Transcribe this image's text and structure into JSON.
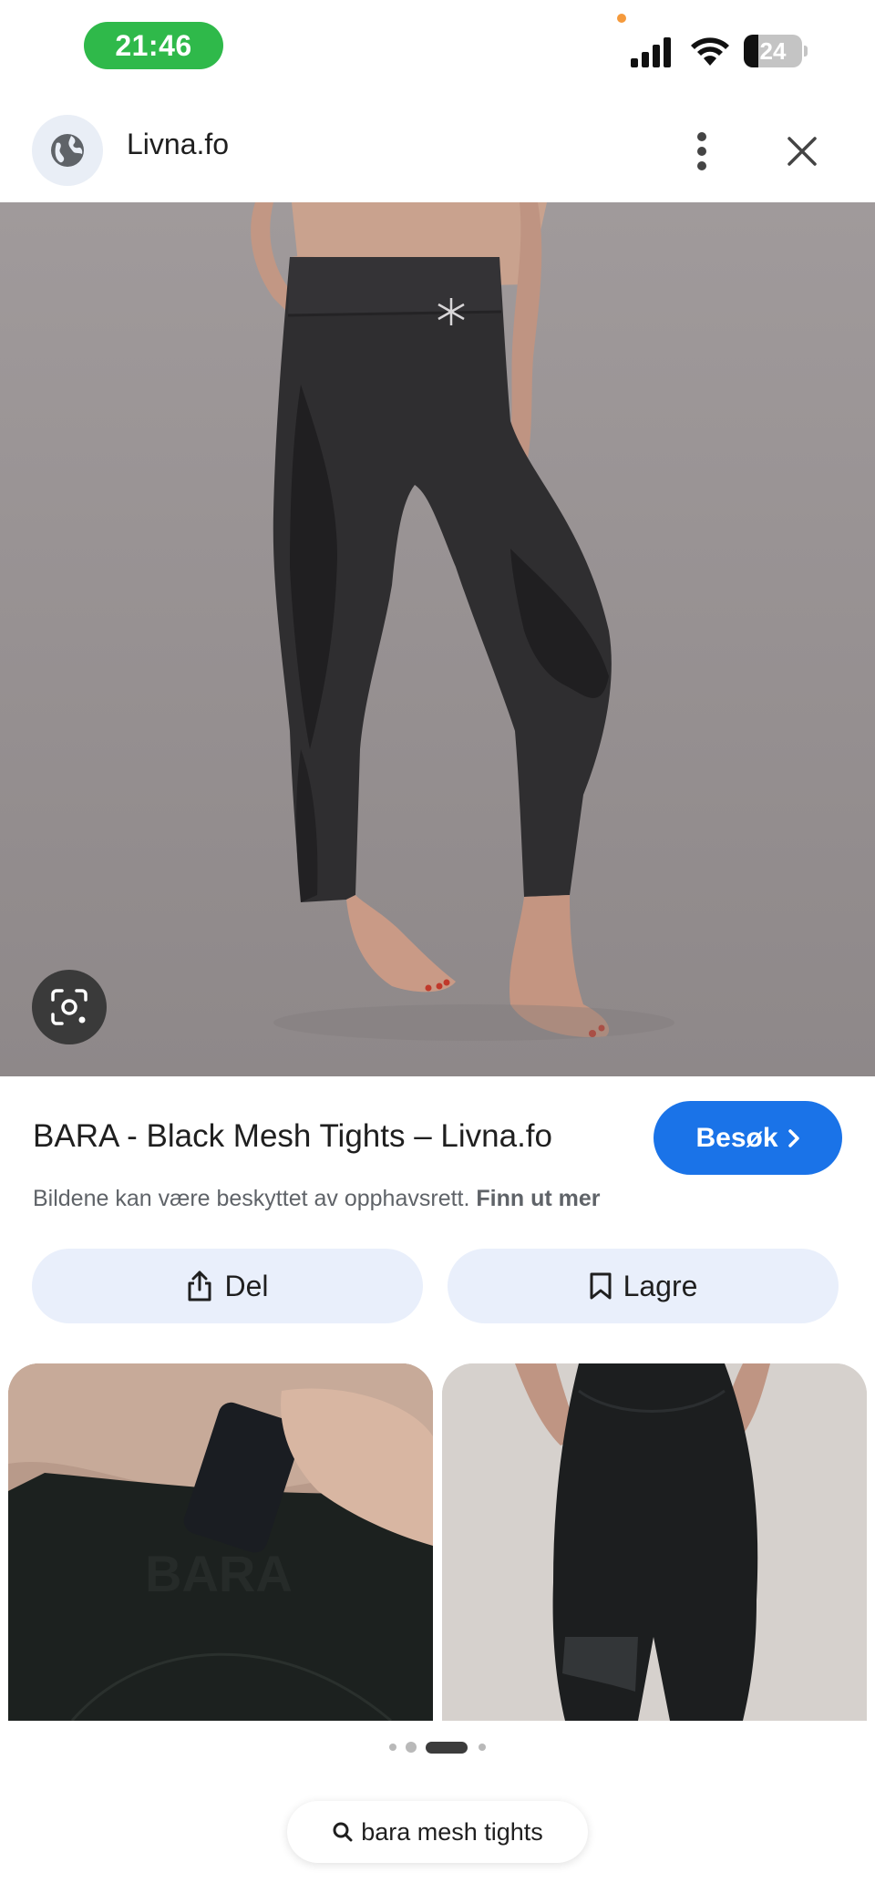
{
  "status_bar": {
    "time": "21:46",
    "battery": "24"
  },
  "header": {
    "site_name": "Livna.fo"
  },
  "result": {
    "title": "BARA - Black Mesh Tights – Livna.fo",
    "visit_label": "Besøk",
    "copyright_text": "Bildene kan være beskyttet av opphavsrett.",
    "learn_more": "Finn ut mer"
  },
  "actions": {
    "share_label": "Del",
    "save_label": "Lagre"
  },
  "thumbnails": [
    {
      "watermark": "BARA"
    },
    {
      "watermark": ""
    }
  ],
  "pagination": {
    "count": 4,
    "active_index": 2
  },
  "search_chip": {
    "query": "bara mesh tights"
  },
  "colors": {
    "accent": "#1a73e8",
    "status_green": "#2fb94a",
    "chip_bg": "#e9effb"
  },
  "icons": [
    "globe-icon",
    "more-vert-icon",
    "close-icon",
    "google-lens-icon",
    "chevron-right-icon",
    "share-icon",
    "bookmark-icon",
    "search-icon"
  ]
}
